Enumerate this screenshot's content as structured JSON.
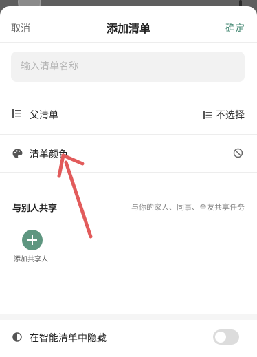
{
  "header": {
    "cancel_label": "取消",
    "title": "添加清单",
    "confirm_label": "确定"
  },
  "name_field": {
    "placeholder": "输入清单名称",
    "value": ""
  },
  "parent_list": {
    "label": "父清单",
    "value": "不选择"
  },
  "list_color": {
    "label": "清单颜色"
  },
  "share": {
    "title": "与别人共享",
    "description": "与你的家人、同事、舍友共享任务",
    "add_label": "添加共享人"
  },
  "smart_hide": {
    "label": "在智能清单中隐藏",
    "enabled": false
  },
  "colors": {
    "accent": "#4f8f7b",
    "annotation_arrow": "#e25b5b"
  }
}
